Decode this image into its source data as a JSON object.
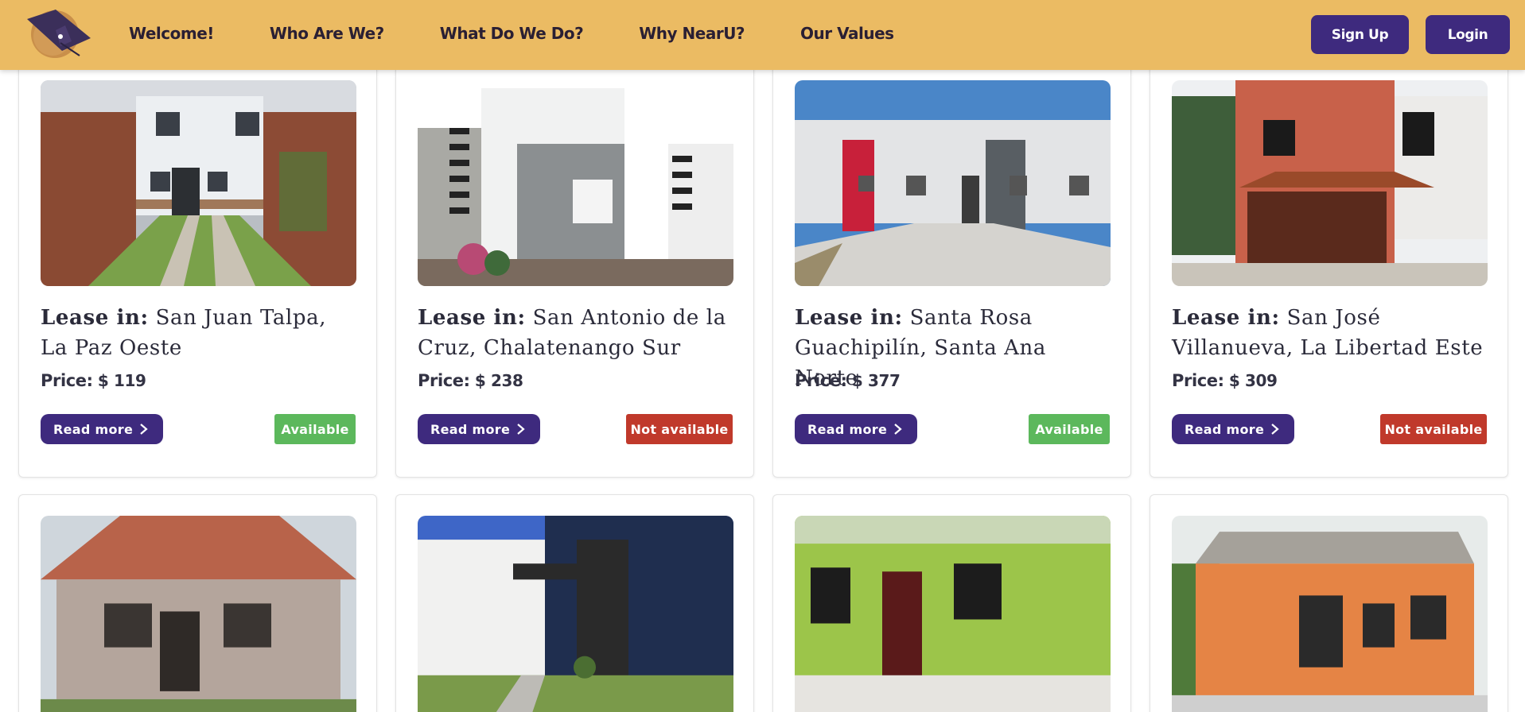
{
  "header": {
    "nav": [
      "Welcome!",
      "Who Are We?",
      "What Do We Do?",
      "Why NearU?",
      "Our Values"
    ],
    "signup_label": "Sign Up",
    "login_label": "Login",
    "bg_color": "#ebbb63",
    "accent_color": "#3e2a7e"
  },
  "listings": [
    {
      "lease_label": "Lease in:",
      "location": "San Juan Talpa, La Paz Oeste",
      "price_label": "Price:",
      "price": "$ 119",
      "read_more": "Read more",
      "status": "Available"
    },
    {
      "lease_label": "Lease in:",
      "location": "San Antonio de la Cruz, Chalatenango Sur",
      "price_label": "Price:",
      "price": "$ 238",
      "read_more": "Read more",
      "status": "Not available"
    },
    {
      "lease_label": "Lease in:",
      "location": "Santa Rosa Guachipilín, Santa Ana Norte",
      "price_label": "Price:",
      "price": "$ 377",
      "read_more": "Read more",
      "status": "Available"
    },
    {
      "lease_label": "Lease in:",
      "location": "San José Villanueva, La Libertad Este",
      "price_label": "Price:",
      "price": "$ 309",
      "read_more": "Read more",
      "status": "Not available"
    }
  ],
  "status_colors": {
    "Available": "#5cb85c",
    "Not available": "#c0392b"
  }
}
